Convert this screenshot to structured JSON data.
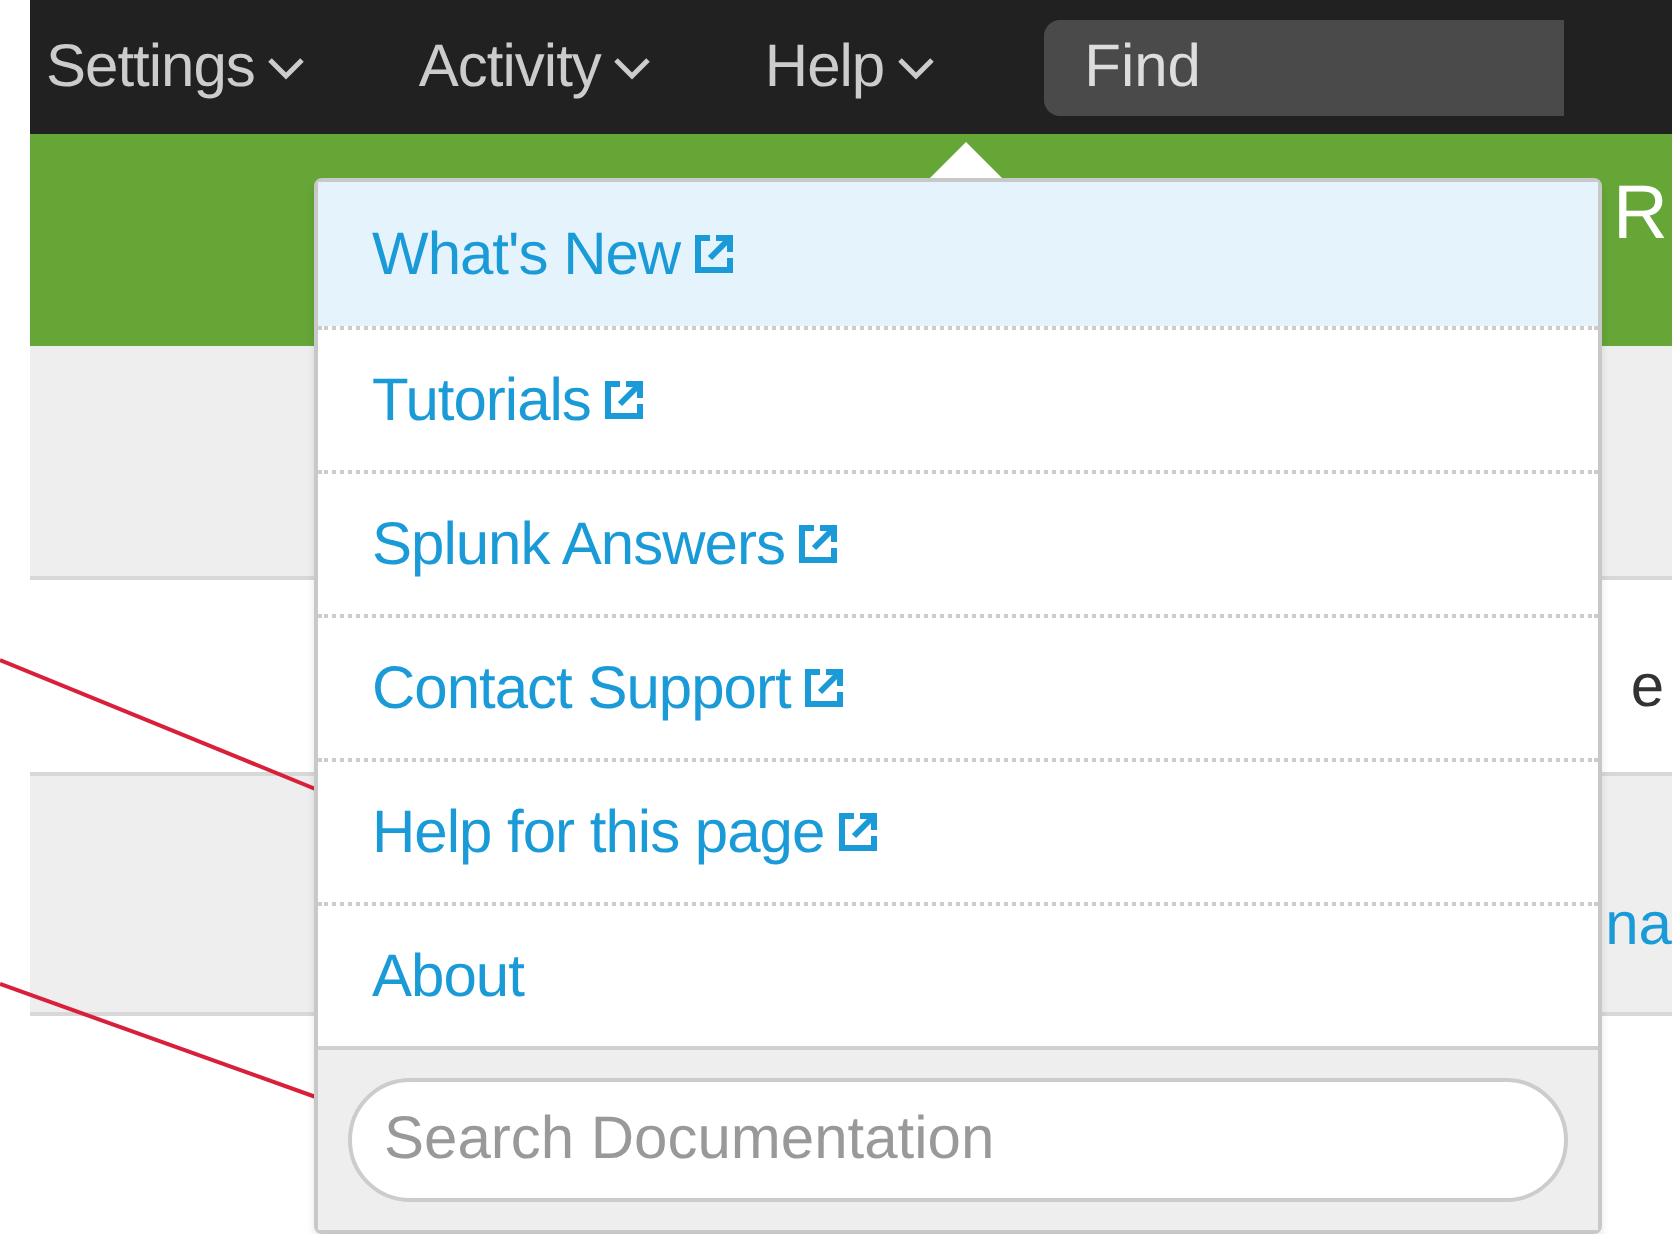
{
  "top_bar": {
    "menus": [
      {
        "label": "Settings"
      },
      {
        "label": "Activity"
      },
      {
        "label": "Help"
      }
    ],
    "find": {
      "placeholder": "Find"
    }
  },
  "header": {
    "title": "R"
  },
  "page": {
    "row_text": "e",
    "link_text": "na"
  },
  "help_menu": {
    "items": [
      {
        "label": "What's New",
        "external": true,
        "selected": true
      },
      {
        "label": "Tutorials",
        "external": true,
        "selected": false
      },
      {
        "label": "Splunk Answers",
        "external": true,
        "selected": false
      },
      {
        "label": "Contact Support",
        "external": true,
        "selected": false
      },
      {
        "label": "Help for this page",
        "external": true,
        "selected": false
      },
      {
        "label": "About",
        "external": false,
        "selected": false
      }
    ],
    "search": {
      "placeholder": "Search Documentation"
    }
  }
}
